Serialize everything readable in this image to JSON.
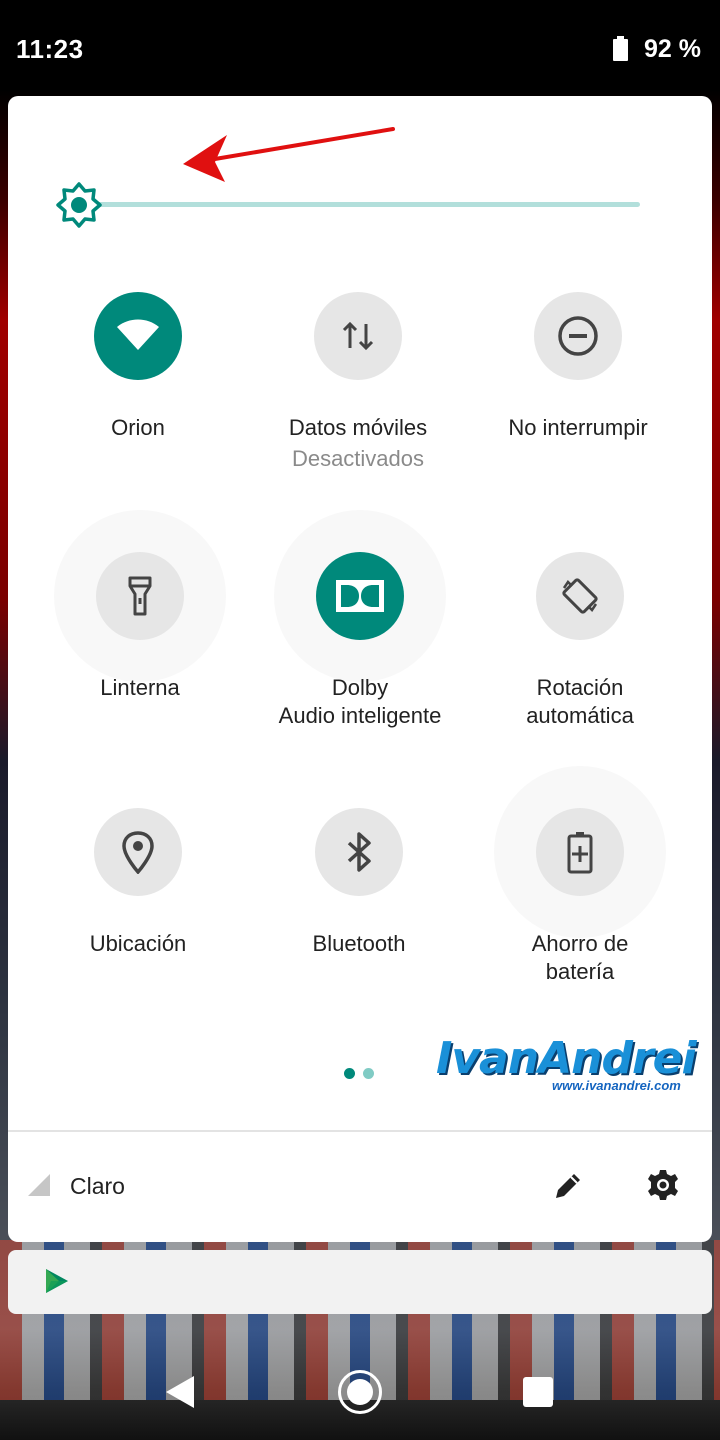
{
  "status_bar": {
    "time": "11:23",
    "battery_percent": "92 %",
    "battery_icon": "battery-full-icon"
  },
  "brightness": {
    "icon": "brightness-icon",
    "level": 0.0,
    "accent_color": "#00897b",
    "track_color": "#b2dfdb",
    "annotation_arrow_color": "#e01010"
  },
  "tiles": [
    {
      "name": "wifi",
      "icon": "wifi-icon",
      "label": "Orion",
      "sublabel": "",
      "active": true
    },
    {
      "name": "mobile-data",
      "icon": "mobile-data-icon",
      "label": "Datos móviles",
      "sublabel": "Desactivados",
      "active": false
    },
    {
      "name": "do-not-disturb",
      "icon": "do-not-disturb-icon",
      "label": "No interrumpir",
      "sublabel": "",
      "active": false
    },
    {
      "name": "flashlight",
      "icon": "flashlight-icon",
      "label": "Linterna",
      "sublabel": "",
      "active": false
    },
    {
      "name": "dolby",
      "icon": "dolby-icon",
      "label": "Dolby",
      "label2": "Audio inteligente",
      "active": true
    },
    {
      "name": "auto-rotate",
      "icon": "rotate-icon",
      "label": "Rotación",
      "label2": "automática",
      "active": false
    },
    {
      "name": "location",
      "icon": "location-pin-icon",
      "label": "Ubicación",
      "sublabel": "",
      "active": false
    },
    {
      "name": "bluetooth",
      "icon": "bluetooth-icon",
      "label": "Bluetooth",
      "sublabel": "",
      "active": false
    },
    {
      "name": "battery-saver",
      "icon": "battery-saver-icon",
      "label": "Ahorro de",
      "label2": "batería",
      "active": false
    }
  ],
  "pagination": {
    "pages": 2,
    "current": 1
  },
  "watermark": {
    "title": "IvanAndrei",
    "url": "www.ivanandrei.com"
  },
  "footer": {
    "carrier": "Claro",
    "signal_icon": "signal-icon",
    "edit_icon": "edit-icon",
    "settings_icon": "settings-icon"
  },
  "notification": {
    "icon": "play-store-icon"
  },
  "nav_bar": {
    "back_icon": "back-icon",
    "home_icon": "home-icon",
    "recents_icon": "recents-icon"
  }
}
